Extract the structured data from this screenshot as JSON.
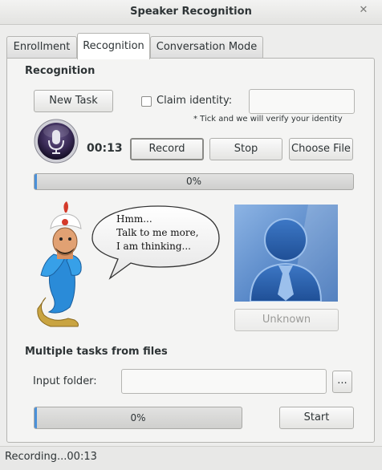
{
  "window": {
    "title": "Speaker Recognition",
    "close_glyph": "✕"
  },
  "tabs": [
    {
      "label": "Enrollment",
      "active": false
    },
    {
      "label": "Recognition",
      "active": true
    },
    {
      "label": "Conversation Mode",
      "active": false
    }
  ],
  "recognition": {
    "section_title": "Recognition",
    "new_task_label": "New Task",
    "claim_identity_label": "Claim identity:",
    "claim_identity_checked": false,
    "claim_identity_value": "",
    "hint": "* Tick and we will verify your identity",
    "timer": "00:13",
    "record_label": "Record",
    "stop_label": "Stop",
    "choose_file_label": "Choose File",
    "progress_text": "0%",
    "progress_value": 0,
    "speech_lines": [
      "Hmm...",
      "Talk to me more,",
      "I am thinking..."
    ],
    "result_label": "Unknown",
    "mic_icon": "microphone-icon",
    "genie_icon": "genie-illustration",
    "avatar_icon": "user-silhouette-icon"
  },
  "multiple": {
    "section_title": "Multiple tasks from files",
    "input_folder_label": "Input folder:",
    "input_folder_value": "",
    "browse_label": "...",
    "progress_text": "0%",
    "progress_value": 0,
    "start_label": "Start"
  },
  "status": {
    "text": "Recording...00:13"
  },
  "colors": {
    "accent": "#4a90d9",
    "avatar_bg": "#5a8fcf",
    "mic_purple": "#3a2b57"
  }
}
